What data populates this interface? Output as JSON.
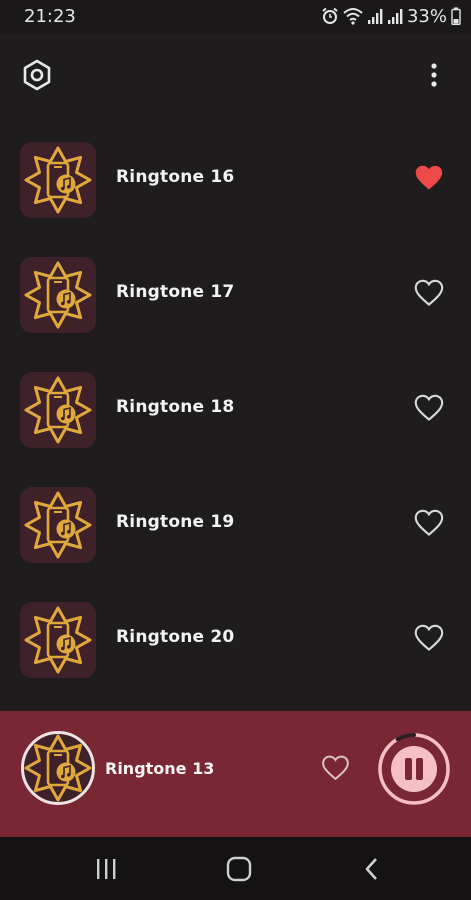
{
  "status_bar": {
    "time": "21:23",
    "battery": "33%",
    "icons": [
      "alarm-icon",
      "wifi-icon",
      "signal-icon",
      "signal-icon",
      "battery-icon"
    ]
  },
  "toolbar": {
    "settings_icon": "settings-hexagon-icon",
    "more_icon": "more-vertical-icon"
  },
  "ringtones": [
    {
      "title": "Ringtone 16",
      "favorite": true
    },
    {
      "title": "Ringtone 17",
      "favorite": false
    },
    {
      "title": "Ringtone 18",
      "favorite": false
    },
    {
      "title": "Ringtone 19",
      "favorite": false
    },
    {
      "title": "Ringtone 20",
      "favorite": false
    }
  ],
  "now_playing": {
    "title": "Ringtone 13",
    "favorite": false,
    "state_icon": "pause-icon",
    "progress_fraction": 0.08
  },
  "nav_bar": {
    "icons": [
      "recents-icon",
      "home-icon",
      "back-icon"
    ]
  },
  "colors": {
    "background": "#1e1c1c",
    "thumb_bg": "#3e2129",
    "gold": "#e0a93c",
    "favorite_red": "#ee4a4a",
    "player_bg": "#7a2734"
  }
}
